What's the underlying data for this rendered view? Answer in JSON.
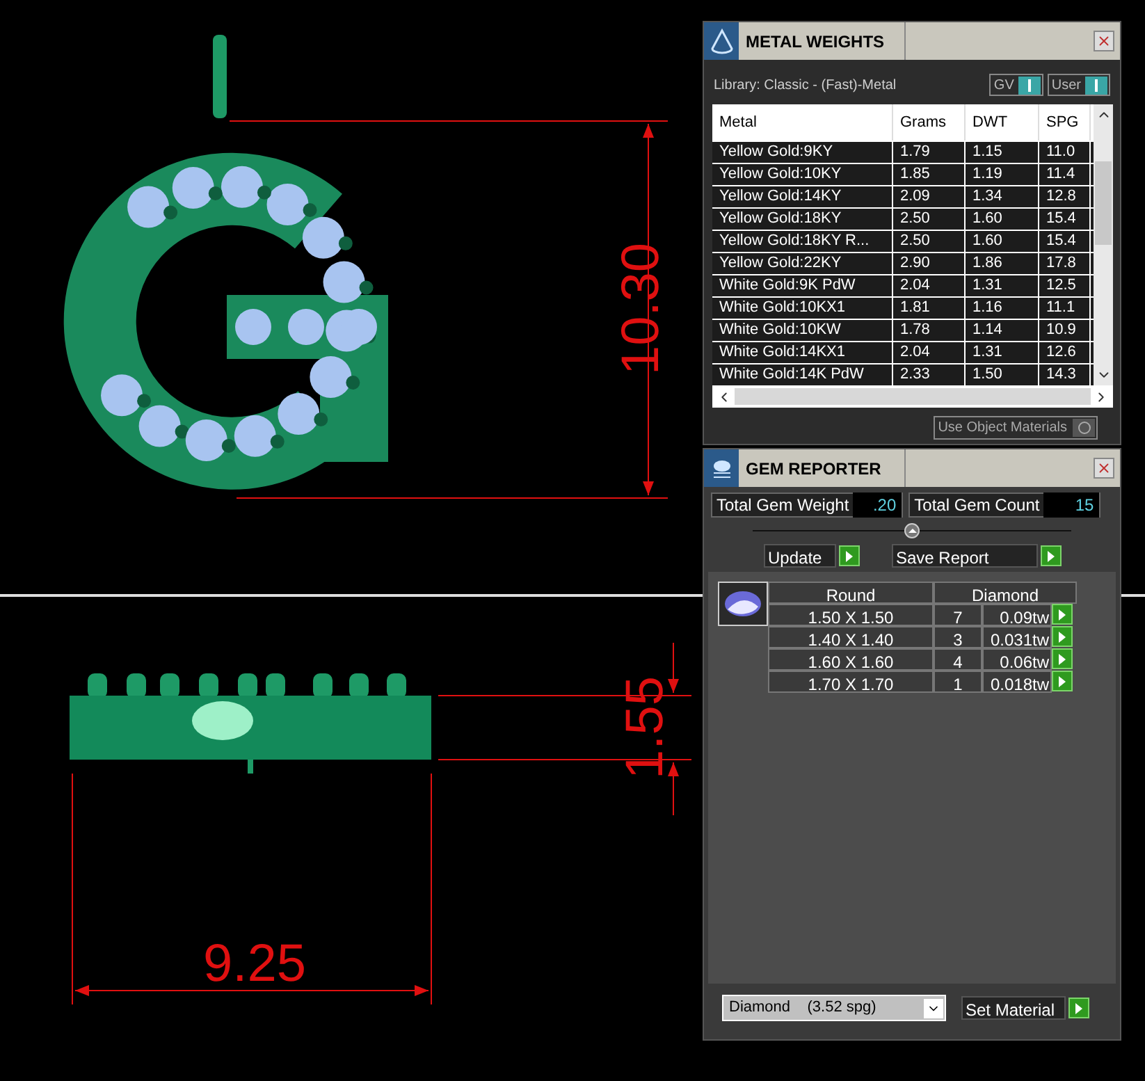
{
  "viewport": {
    "height_label": "10.30",
    "thickness_label": "1.55",
    "width_label": "9.25"
  },
  "metal_weights": {
    "title": "METAL WEIGHTS",
    "library": "Library: Classic - (Fast)-Metal",
    "toggles": [
      {
        "label": "GV",
        "on": true
      },
      {
        "label": "User",
        "on": true
      }
    ],
    "columns": [
      "Metal",
      "Grams",
      "DWT",
      "SPG"
    ],
    "rows": [
      [
        "Yellow Gold:9KY",
        "1.79",
        "1.15",
        "11.0"
      ],
      [
        "Yellow Gold:10KY",
        "1.85",
        "1.19",
        "11.4"
      ],
      [
        "Yellow Gold:14KY",
        "2.09",
        "1.34",
        "12.8"
      ],
      [
        "Yellow Gold:18KY",
        "2.50",
        "1.60",
        "15.4"
      ],
      [
        "Yellow Gold:18KY R...",
        "2.50",
        "1.60",
        "15.4"
      ],
      [
        "Yellow Gold:22KY",
        "2.90",
        "1.86",
        "17.8"
      ],
      [
        "White Gold:9K PdW",
        "2.04",
        "1.31",
        "12.5"
      ],
      [
        "White Gold:10KX1",
        "1.81",
        "1.16",
        "11.1"
      ],
      [
        "White Gold:10KW",
        "1.78",
        "1.14",
        "10.9"
      ],
      [
        "White Gold:14KX1",
        "2.04",
        "1.31",
        "12.6"
      ],
      [
        "White Gold:14K PdW",
        "2.33",
        "1.50",
        "14.3"
      ]
    ],
    "use_object_materials": {
      "label": "Use Object Materials",
      "on": false
    }
  },
  "gem_reporter": {
    "title": "GEM REPORTER",
    "totals": [
      {
        "label": "Total Gem Weight",
        "value": ".20"
      },
      {
        "label": "Total Gem Count",
        "value": "15"
      }
    ],
    "buttons": [
      "Update",
      "Save Report"
    ],
    "shape": "Round",
    "material": "Diamond",
    "rows": [
      {
        "size": "1.50 X 1.50",
        "count": "7",
        "weight": "0.09tw"
      },
      {
        "size": "1.40 X 1.40",
        "count": "3",
        "weight": "0.031tw"
      },
      {
        "size": "1.60 X 1.60",
        "count": "4",
        "weight": "0.06tw"
      },
      {
        "size": "1.70 X 1.70",
        "count": "1",
        "weight": "0.018tw"
      }
    ],
    "material_select": {
      "value": "Diamond    (3.52 spg)"
    },
    "set_material": "Set Material"
  }
}
